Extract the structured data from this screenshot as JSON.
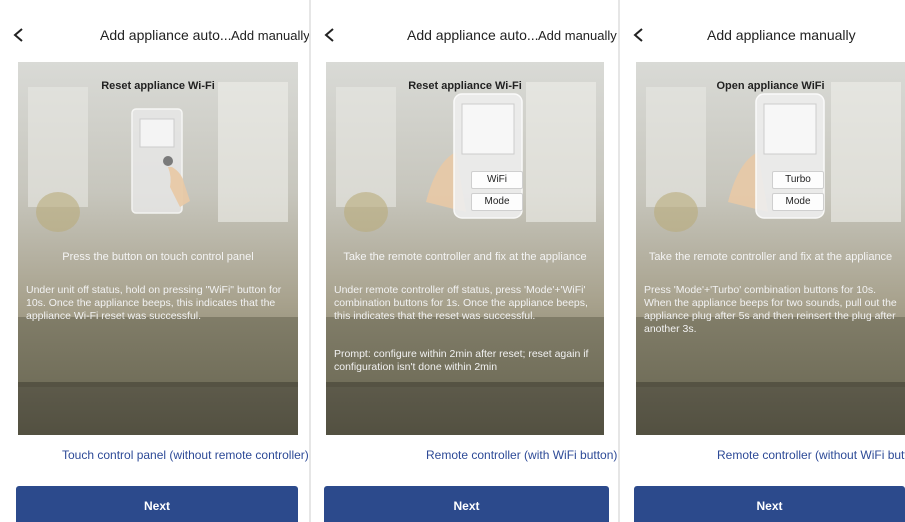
{
  "colors": {
    "accent": "#2c4a8c",
    "link": "#2d4a97"
  },
  "icons": {
    "back": "chevron-left-icon"
  },
  "panels": [
    {
      "title": "Add appliance auto...",
      "add_manually": "Add manually",
      "step_title": "Reset appliance Wi-Fi",
      "caption": "Press the button on touch control panel",
      "description": "Under unit off status, hold on pressing \"WiFi\" button for 10s. Once the appliance beeps, this indicates that the appliance Wi-Fi reset was successful.",
      "link": "Touch control panel (without remote controller)",
      "next": "Next"
    },
    {
      "title": "Add appliance auto...",
      "add_manually": "Add manually",
      "step_title": "Reset appliance Wi-Fi",
      "buttons": [
        "WiFi",
        "Mode"
      ],
      "caption": "Take the remote controller and fix at the appliance",
      "description": "Under remote controller off status, press 'Mode'+'WiFi' combination buttons for 1s. Once the appliance beeps, this indicates that the reset was successful.",
      "prompt": "Prompt: configure within 2min after reset; reset again if configuration isn't done within 2min",
      "link": "Remote controller (with WiFi button)",
      "next": "Next"
    },
    {
      "title": "Add appliance manually",
      "step_title": "Open appliance WiFi",
      "buttons": [
        "Turbo",
        "Mode"
      ],
      "caption": "Take the remote controller and fix at the appliance",
      "description": "Press 'Mode'+'Turbo' combination buttons for 10s. When the appliance beeps for two sounds, pull out the appliance plug after 5s and then reinsert the plug after another 3s.",
      "link": "Remote controller (without WiFi button",
      "next": "Next"
    }
  ]
}
